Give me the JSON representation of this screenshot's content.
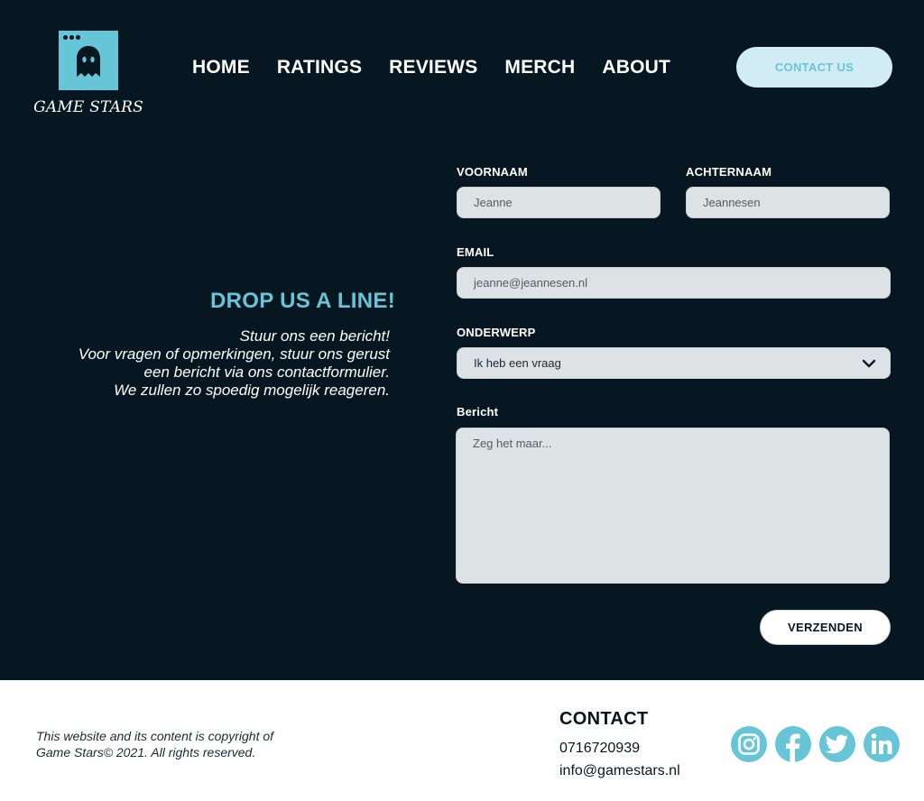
{
  "brand": {
    "name": "GAME STARS",
    "icon": "ghost-icon"
  },
  "nav": {
    "items": [
      "HOME",
      "RATINGS",
      "REVIEWS",
      "MERCH",
      "ABOUT"
    ],
    "contact_label": "CONTACT US"
  },
  "intro": {
    "title": "DROP US A LINE!",
    "text": "Stuur ons een bericht!\nVoor vragen of opmerkingen, stuur ons gerust\neen bericht via ons contactformulier.\nWe zullen zo spoedig mogelijk reageren."
  },
  "form": {
    "first_name": {
      "label": "VOORNAAM",
      "placeholder": "Jeanne"
    },
    "last_name": {
      "label": "ACHTERNAAM",
      "placeholder": "Jeannesen"
    },
    "email": {
      "label": "EMAIL",
      "placeholder": "jeanne@jeannesen.nl"
    },
    "subject": {
      "label": "ONDERWERP",
      "value": "Ik heb een vraag"
    },
    "message": {
      "label": "Bericht",
      "placeholder": "Zeg het maar..."
    },
    "submit_label": "VERZENDEN"
  },
  "footer": {
    "copyright": "This website and its content is copyright of\nGame Stars© 2021. All rights reserved.",
    "contact_title": "CONTACT",
    "phone": "0716720939",
    "email": "info@gamestars.nl",
    "social": [
      "instagram-icon",
      "facebook-icon",
      "twitter-icon",
      "linkedin-icon"
    ]
  },
  "colors": {
    "background": "#071721",
    "accent": "#67c5d8",
    "field": "#dde2e4",
    "button_light": "#d2ecf5"
  }
}
